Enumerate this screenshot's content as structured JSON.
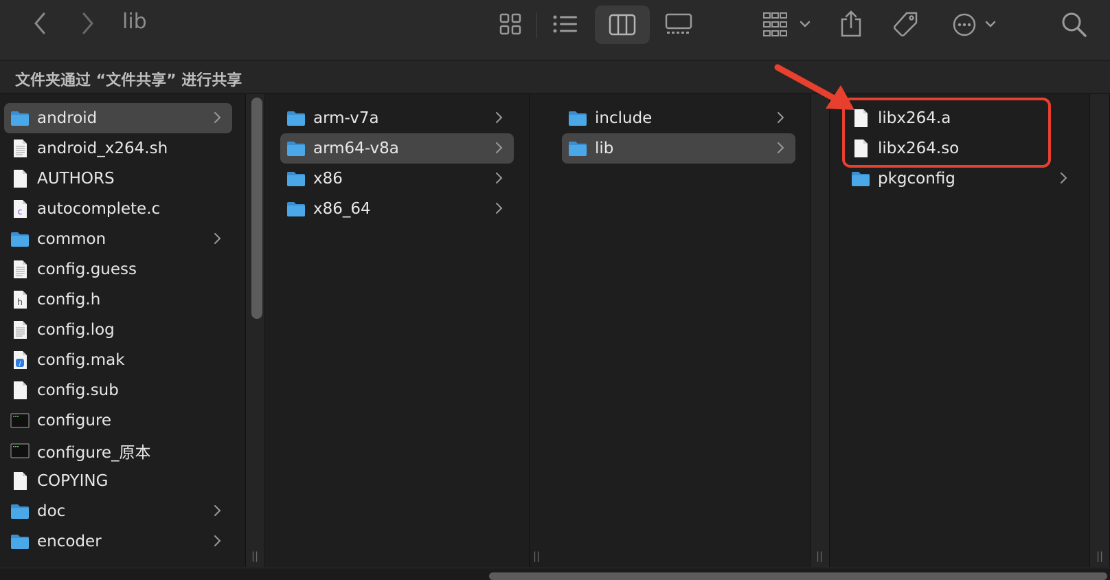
{
  "window": {
    "title": "lib"
  },
  "toolbar": {
    "back": "‹",
    "forward": "›",
    "icons": [
      "grid-view-icon",
      "list-view-icon",
      "column-view-icon",
      "gallery-view-icon",
      "group-icon",
      "share-icon",
      "tag-icon",
      "more-icon",
      "search-icon"
    ]
  },
  "pathbar": {
    "text": "文件夹通过 “文件共享” 进行共享"
  },
  "columns": [
    {
      "items": [
        {
          "name": "android",
          "icon": "folder",
          "chevron": true,
          "selected": true
        },
        {
          "name": "android_x264.sh",
          "icon": "doc-text",
          "chevron": false
        },
        {
          "name": "AUTHORS",
          "icon": "doc",
          "chevron": false
        },
        {
          "name": "autocomplete.c",
          "icon": "doc-c",
          "chevron": false
        },
        {
          "name": "common",
          "icon": "folder",
          "chevron": true
        },
        {
          "name": "config.guess",
          "icon": "doc-text",
          "chevron": false
        },
        {
          "name": "config.h",
          "icon": "doc-h",
          "chevron": false
        },
        {
          "name": "config.log",
          "icon": "doc-text",
          "chevron": false
        },
        {
          "name": "config.mak",
          "icon": "doc-blue",
          "chevron": false
        },
        {
          "name": "config.sub",
          "icon": "doc",
          "chevron": false
        },
        {
          "name": "configure",
          "icon": "terminal",
          "chevron": false
        },
        {
          "name": "configure_原本",
          "icon": "terminal",
          "chevron": false
        },
        {
          "name": "COPYING",
          "icon": "doc",
          "chevron": false
        },
        {
          "name": "doc",
          "icon": "folder",
          "chevron": true
        },
        {
          "name": "encoder",
          "icon": "folder",
          "chevron": true
        }
      ]
    },
    {
      "items": [
        {
          "name": "arm-v7a",
          "icon": "folder",
          "chevron": true
        },
        {
          "name": "arm64-v8a",
          "icon": "folder",
          "chevron": true,
          "selected": true
        },
        {
          "name": "x86",
          "icon": "folder",
          "chevron": true
        },
        {
          "name": "x86_64",
          "icon": "folder",
          "chevron": true
        }
      ]
    },
    {
      "items": [
        {
          "name": "include",
          "icon": "folder",
          "chevron": true
        },
        {
          "name": "lib",
          "icon": "folder",
          "chevron": true,
          "selected": true
        }
      ]
    },
    {
      "items": [
        {
          "name": "libx264.a",
          "icon": "doc",
          "chevron": false
        },
        {
          "name": "libx264.so",
          "icon": "doc",
          "chevron": false
        },
        {
          "name": "pkgconfig",
          "icon": "folder",
          "chevron": true
        }
      ]
    }
  ],
  "colors": {
    "annotation": "#e8402f",
    "folder": "#4aa8e8",
    "selection": "#464646"
  }
}
